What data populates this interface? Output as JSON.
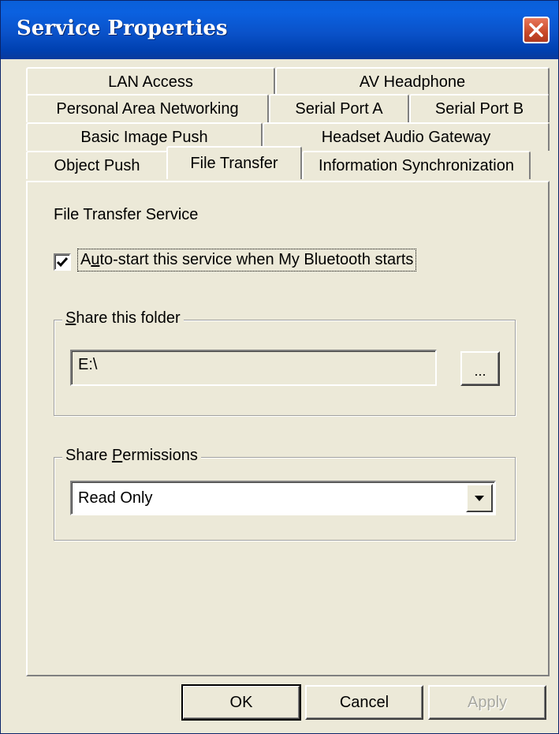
{
  "window": {
    "title": "Service Properties",
    "close_icon": "close-icon"
  },
  "tabs": {
    "row1": [
      "LAN Access",
      "AV Headphone"
    ],
    "row2": [
      "Personal Area Networking",
      "Serial Port A",
      "Serial Port B"
    ],
    "row3": [
      "Basic Image Push",
      "Headset Audio Gateway"
    ],
    "row4": [
      "Object Push",
      "File Transfer",
      "Information Synchronization"
    ],
    "active": "File Transfer"
  },
  "panel": {
    "service_title": "File Transfer Service",
    "autostart": {
      "label_prefix": "A",
      "label_mnemonic": "u",
      "label_rest": "to-start this service when My Bluetooth starts",
      "checked": true
    },
    "share_folder": {
      "title_mnemonic": "S",
      "title_rest": "hare this folder",
      "path": "E:\\",
      "browse_label": "..."
    },
    "share_permissions": {
      "title_prefix": "Share ",
      "title_mnemonic": "P",
      "title_rest": "ermissions",
      "selected": "Read Only"
    }
  },
  "buttons": {
    "ok": "OK",
    "cancel": "Cancel",
    "apply": "Apply"
  },
  "colors": {
    "titlebar": "#0a52c9",
    "face": "#ece9d8",
    "close": "#c94a2a"
  }
}
